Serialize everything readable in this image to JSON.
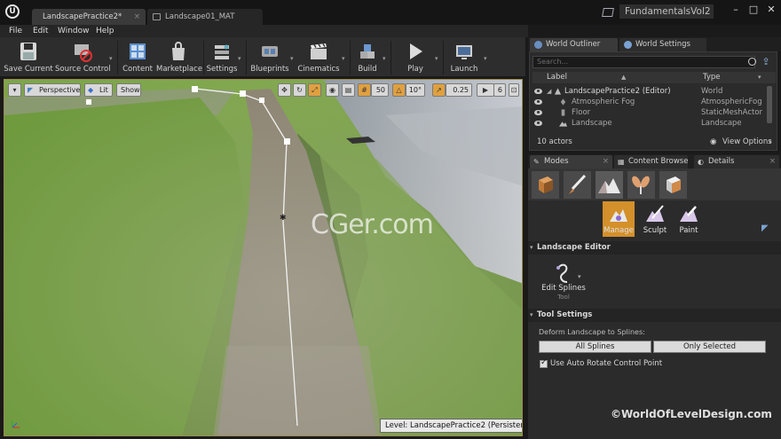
{
  "window": {
    "tabs": [
      {
        "label": "LandscapePractice2*",
        "active": true
      },
      {
        "label": "Landscape01_MAT",
        "active": false
      }
    ],
    "project_name": "FundamentalsVol2",
    "controls": [
      "–",
      "□",
      "✕"
    ]
  },
  "menu": [
    "File",
    "Edit",
    "Window",
    "Help"
  ],
  "toolbar": {
    "items": [
      {
        "label": "Save Current",
        "icon": "save-icon"
      },
      {
        "label": "Source Control",
        "icon": "source-control-icon"
      },
      {
        "label": "Content",
        "icon": "content-icon"
      },
      {
        "label": "Marketplace",
        "icon": "marketplace-icon"
      },
      {
        "label": "Settings",
        "icon": "settings-icon"
      },
      {
        "label": "Blueprints",
        "icon": "blueprints-icon"
      },
      {
        "label": "Cinematics",
        "icon": "cinematics-icon"
      },
      {
        "label": "Build",
        "icon": "build-icon"
      },
      {
        "label": "Play",
        "icon": "play-icon"
      },
      {
        "label": "Launch",
        "icon": "launch-icon"
      }
    ]
  },
  "viewport": {
    "perspective_label": "Perspective",
    "lit_label": "Lit",
    "show_label": "Show",
    "grid_snap": "50",
    "rotation_snap": "10°",
    "scale_snap": "0.25",
    "camera_speed": "6",
    "watermark": "CGer.com",
    "level_label": "Level:  LandscapePractice2 (Persistent)",
    "colors": {
      "accent": "#e0a040",
      "border": "#9c8a4a"
    }
  },
  "outliner": {
    "tabs": [
      {
        "label": "World Outliner",
        "active": true
      },
      {
        "label": "World Settings",
        "active": false
      }
    ],
    "search_placeholder": "Search...",
    "columns": {
      "label": "Label",
      "type": "Type"
    },
    "rows": [
      {
        "label": "LandscapePractice2 (Editor)",
        "type": "World",
        "icon": "world-icon"
      },
      {
        "label": "Atmospheric Fog",
        "type": "AtmosphericFog",
        "icon": "fog-icon"
      },
      {
        "label": "Floor",
        "type": "StaticMeshActor",
        "icon": "mesh-icon"
      },
      {
        "label": "Landscape",
        "type": "Landscape",
        "icon": "landscape-icon"
      }
    ],
    "actor_count": "10 actors",
    "view_options": "View Options"
  },
  "panel": {
    "tabs": [
      {
        "label": "Modes",
        "active": true
      },
      {
        "label": "Content Browse",
        "active": false
      },
      {
        "label": "Details",
        "active": false
      }
    ],
    "mode_icons": [
      "place-mode-icon",
      "paint-mode-icon",
      "landscape-mode-icon",
      "foliage-mode-icon",
      "geometry-mode-icon"
    ],
    "subtools": [
      {
        "label": "Manage",
        "active": true
      },
      {
        "label": "Sculpt",
        "active": false
      },
      {
        "label": "Paint",
        "active": false
      }
    ],
    "landscape_editor_label": "Landscape Editor",
    "edit_splines_label": "Edit Splines",
    "tool_sub_label": "Tool",
    "tool_settings_label": "Tool Settings",
    "deform_label": "Deform Landscape to Splines:",
    "all_splines_label": "All Splines",
    "only_selected_label": "Only Selected",
    "auto_rotate_label": "Use Auto Rotate Control Point",
    "auto_rotate_checked": true
  },
  "watermark_brand": "©WorldOfLevelDesign.com"
}
